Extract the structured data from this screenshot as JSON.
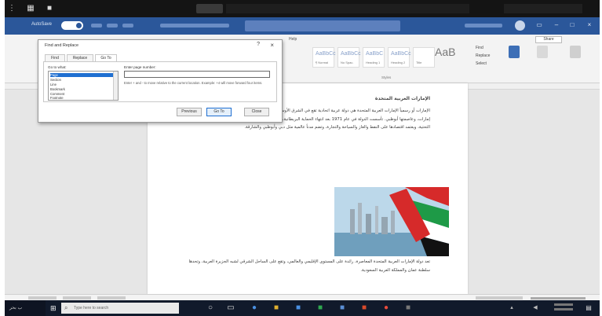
{
  "topbar": {
    "apps_icon": "grid-icon",
    "camera_icon": "camera-icon"
  },
  "titlebar": {
    "autosave_label": "AutoSave",
    "document_title": "",
    "user_name": "",
    "color": "#2b579a"
  },
  "ribbon": {
    "help_tab": "Help",
    "share_label": "Share",
    "aab": "AaB",
    "find_label": "Find",
    "replace_label": "Replace",
    "select_label": "Select"
  },
  "dialog": {
    "title": "Find and Replace",
    "help": "?",
    "close": "×",
    "tabs": [
      "Find",
      "Replace",
      "Go To"
    ],
    "goto_what_label": "Go to what:",
    "goto_options": [
      "Page",
      "Section",
      "Line",
      "Bookmark",
      "Comment",
      "Footnote"
    ],
    "enter_label": "Enter page number:",
    "hint": "Enter + and - to move relative to the current location. Example: +4 will move forward four items.",
    "previous": "Previous",
    "goto_button": "Go To",
    "close_button": "Close"
  },
  "document": {
    "heading": "الإمارات العربية المتحدة",
    "paragraph1": "الإمارات أو رسمياً الإمارات العربية المتحدة هي دولة عربية اتحادية تقع في الشرق الأوسط، على الساحل الجنوبي للخليج العربي. تتكون من سبع إمارات، وعاصمتها أبوظبي. تأسست الدولة في عام 1971 بعد انتهاء الحماية البريطانية، وتعد من أكثر دول المنطقة تطوراً في الاقتصاد والبنية التحتية، ويعتمد اقتصادها على النفط والغاز والسياحة والتجارة، وتضم مدناً عالمية مثل دبي وأبوظبي والشارقة.",
    "paragraph2": "تعد دولة الإمارات العربية المتحدة المعاصرة، رائدة على المستوى الإقليمي والعالمي، وتقع على الساحل الشرقي لشبه الجزيرة العربية، وتحدها سلطنة عمان والمملكة العربية السعودية."
  },
  "taskbar": {
    "search_placeholder": "Type here to search",
    "left_label": "ب بحر"
  }
}
